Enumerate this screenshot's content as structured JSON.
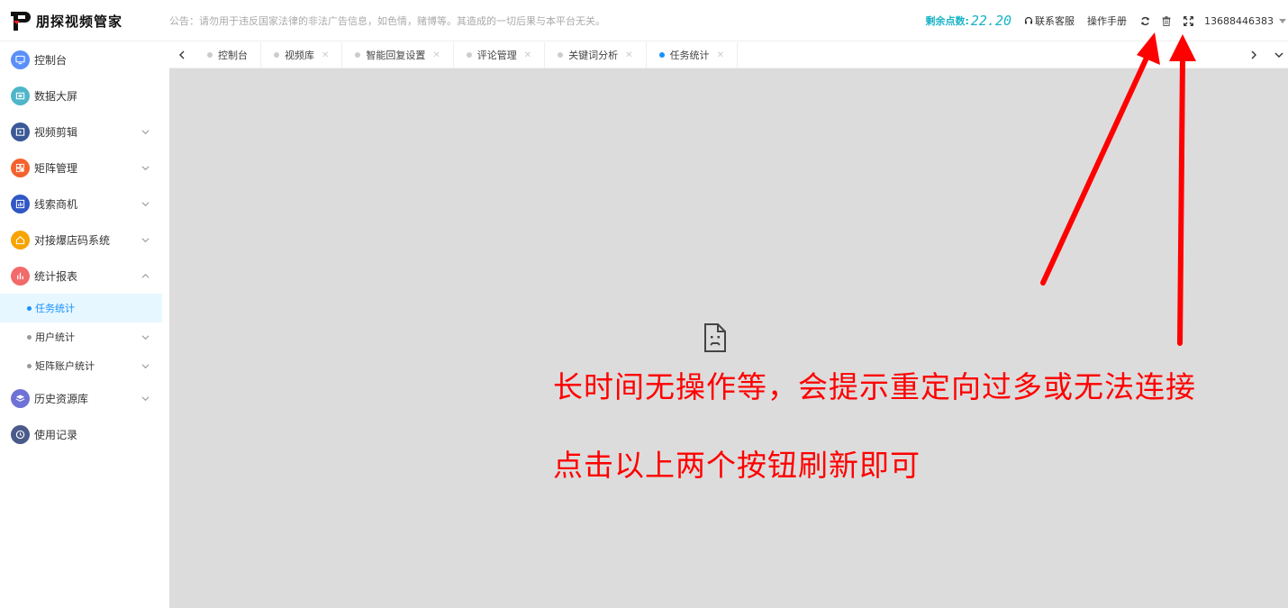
{
  "header": {
    "logo_text": "朋探视频管家",
    "notice": "公告：请勿用于违反国家法律的非法广告信息，如色情，赌博等。其造成的一切后果与本平台无关。",
    "points_label": "剩余点数:",
    "points_value": "22.20",
    "contact_label": "联系客服",
    "manual_label": "操作手册",
    "user_phone": "13688446383"
  },
  "sidebar": {
    "items": [
      {
        "label": "控制台",
        "icon": "monitor-icon",
        "color": "#5b8ff9"
      },
      {
        "label": "数据大屏",
        "icon": "screen-icon",
        "color": "#4fb6c9"
      },
      {
        "label": "视频剪辑",
        "icon": "video-icon",
        "color": "#3b5998"
      },
      {
        "label": "矩阵管理",
        "icon": "matrix-icon",
        "color": "#f5622d"
      },
      {
        "label": "线索商机",
        "icon": "chart-icon",
        "color": "#3057c5"
      },
      {
        "label": "对接爆店码系统",
        "icon": "home-icon",
        "color": "#f7a400"
      },
      {
        "label": "统计报表",
        "icon": "stats-icon",
        "color": "#f26a6a"
      },
      {
        "label": "历史资源库",
        "icon": "layers-icon",
        "color": "#6e72d6"
      },
      {
        "label": "使用记录",
        "icon": "clock-icon",
        "color": "#4a5a8a"
      }
    ],
    "sub_items": [
      {
        "label": "任务统计"
      },
      {
        "label": "用户统计"
      },
      {
        "label": "矩阵账户统计"
      }
    ]
  },
  "tabs": [
    {
      "label": "控制台"
    },
    {
      "label": "视频库"
    },
    {
      "label": "智能回复设置"
    },
    {
      "label": "评论管理"
    },
    {
      "label": "关键词分析"
    },
    {
      "label": "任务统计"
    }
  ],
  "annotation": {
    "line1": "长时间无操作等，会提示重定向过多或无法连接",
    "line2": "点击以上两个按钮刷新即可"
  },
  "colors": {
    "accent": "#1890ff",
    "points": "#1ab3c6",
    "annotation": "#ff0000",
    "content_bg": "#dcdcdc"
  }
}
